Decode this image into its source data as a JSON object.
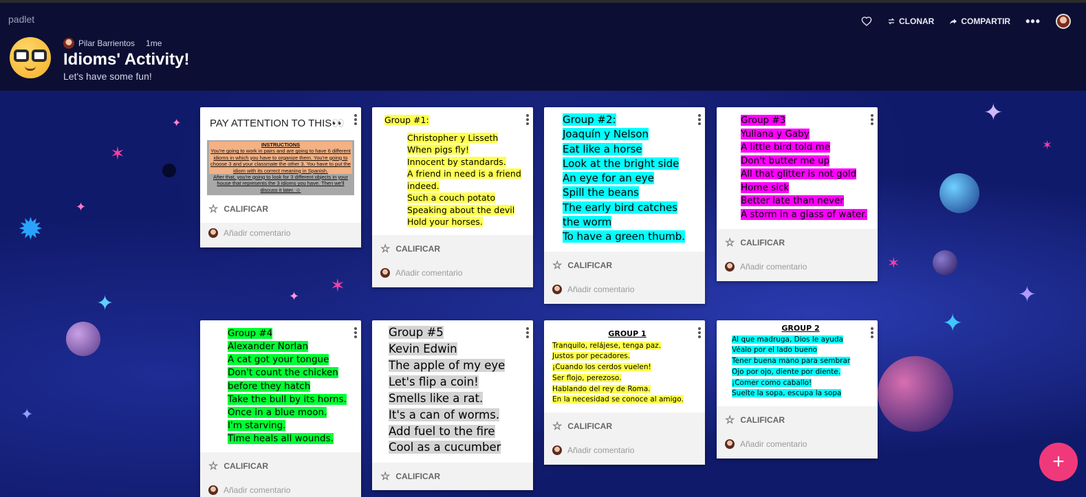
{
  "header": {
    "brand": "padlet",
    "author": "Pilar Barrientos",
    "age": "1me",
    "title": "Idioms' Activity!",
    "subtitle": "Let's have some fun!",
    "clone_label": "CLONAR",
    "share_label": "COMPARTIR"
  },
  "common": {
    "rate_label": "CALIFICAR",
    "comment_placeholder": "Añadir comentario"
  },
  "cards": {
    "attention": {
      "title": "PAY ATTENTION TO THIS👀",
      "image_lines": [
        "INSTRUCTIONS",
        "You're going to work in pairs and are going to have 6 different idioms in which you have to organize them. You're going to choose 3 and your classmate the other 3. You have to put the idiom with its correct meaning in Spanish.",
        "After that, you're going to look for 3 different objects in your house that represents the 3 idioms you have. Then we'll discuss it later. ☺"
      ]
    },
    "g1": [
      "Group #1:",
      "Christopher y Lisseth",
      "When pigs fly!",
      "Innocent by standards.",
      "A friend in need is a friend indeed.",
      "Such a couch potato",
      "Speaking about the devil",
      "Hold your horses."
    ],
    "g2": [
      "Group #2:",
      "Joaquín y Nelson",
      "Eat like a horse",
      "Look at the bright side",
      "An eye for an eye",
      "Spill the beans",
      "The early bird catches the worm",
      "To have a green thumb."
    ],
    "g3": [
      "Group #3",
      "Yuliana y Gaby",
      "A little bird told me",
      "Don't butter me up",
      "All that glitter is not gold",
      "Home sick",
      "Better late than never",
      "A storm in a glass of water."
    ],
    "g4": [
      "Group #4",
      "Alexander Norlan",
      "A cat got your tongue",
      "Don't count the chicken before they hatch",
      "Take the bull by its horns.",
      "Once in a blue moon.",
      "I'm starving.",
      "Time heals all wounds."
    ],
    "g5": [
      "Group #5",
      "Kevin Edwin",
      "The apple of my eye",
      "Let's flip a coin!",
      "Smells like a rat.",
      "It's a can of worms.",
      "Add fuel to the fire",
      "Cool as a cucumber"
    ],
    "gr1": {
      "heading": "GROUP 1",
      "lines": [
        "Tranquilo, relájese, tenga paz.",
        "Justos por pecadores.",
        "¡Cuando los cerdos vuelen!",
        "Ser flojo, perezoso.",
        "Hablando del rey de Roma.",
        "En la necesidad se conoce al amigo."
      ]
    },
    "gr2": {
      "heading": "GROUP 2",
      "lines": [
        "Al que madruga, Dios le ayuda",
        "Véalo por el lado bueno",
        "Tener buena mano para sembrar",
        "Ojo por ojo, diente por diente.",
        "¡Comer como caballo!",
        "Suelte la sopa, escupa la sopa"
      ]
    }
  },
  "colors": {
    "yellow": "#ffff4d",
    "cyan": "#00ffff",
    "magenta": "#ff00ff",
    "green": "#00ff33",
    "gray": "#d4d4d4",
    "fab": "#f0397a"
  }
}
